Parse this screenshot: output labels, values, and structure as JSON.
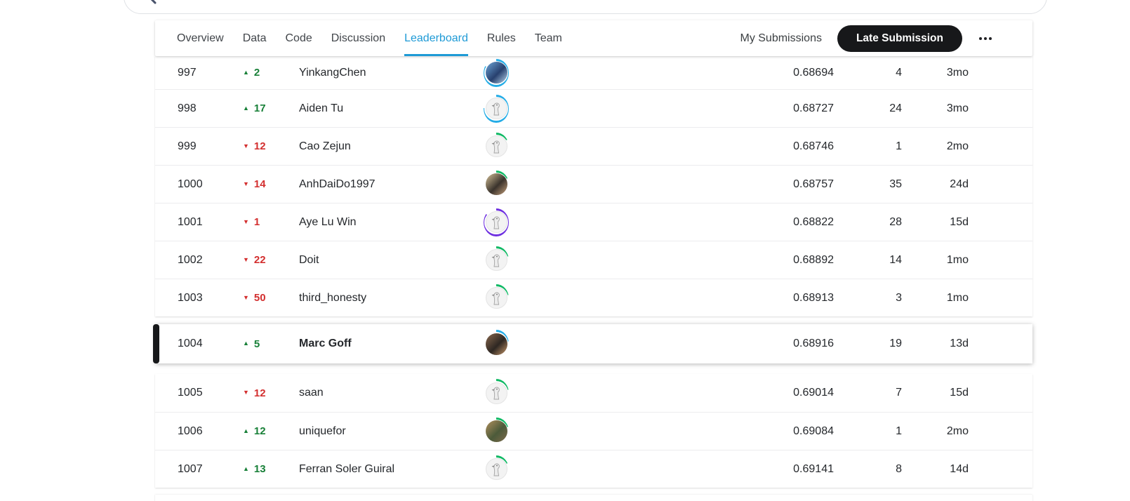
{
  "tabs": {
    "items": [
      "Overview",
      "Data",
      "Code",
      "Discussion",
      "Leaderboard",
      "Rules",
      "Team"
    ],
    "active_index": 4
  },
  "actions": {
    "my_submissions": "My Submissions",
    "late_submission": "Late Submission"
  },
  "icons": {
    "search": "magnifier",
    "more": "ellipsis",
    "up_arrow": "▲",
    "down_arrow": "▼"
  },
  "colors": {
    "accent_blue": "#1e9ad6",
    "positive_green": "#188038",
    "negative_red": "#d32f2f",
    "pill_black": "#17181a",
    "ring_blue": "#24ace6",
    "ring_green": "#0fb964",
    "ring_purple": "#6e30e0"
  },
  "leaderboard": {
    "rows": [
      {
        "rank": "997",
        "dir": "up",
        "change": "2",
        "team": "YinkangChen",
        "score": "0.68694",
        "entries": "4",
        "last": "3mo",
        "avatar": {
          "type": "photo",
          "ring": "#24ace6",
          "ring_pct": 84,
          "photo_colors": [
            "#6ea6d8",
            "#27406e",
            "#b9d6ee"
          ]
        }
      },
      {
        "rank": "998",
        "dir": "up",
        "change": "17",
        "team": "Aiden Tu",
        "score": "0.68727",
        "entries": "24",
        "last": "3mo",
        "avatar": {
          "type": "goose",
          "ring": "#24ace6",
          "ring_pct": 76
        }
      },
      {
        "rank": "999",
        "dir": "down",
        "change": "12",
        "team": "Cao Zejun",
        "score": "0.68746",
        "entries": "1",
        "last": "2mo",
        "avatar": {
          "type": "goose",
          "ring": "#0fb964",
          "ring_pct": 16
        }
      },
      {
        "rank": "1000",
        "dir": "down",
        "change": "14",
        "team": "AnhDaiDo1997",
        "score": "0.68757",
        "entries": "35",
        "last": "24d",
        "avatar": {
          "type": "photo",
          "ring": "#0fb964",
          "ring_pct": 17,
          "photo_colors": [
            "#d8c49a",
            "#3a332c",
            "#c7a17c"
          ]
        }
      },
      {
        "rank": "1001",
        "dir": "down",
        "change": "1",
        "team": "Aye Lu Win",
        "score": "0.68822",
        "entries": "28",
        "last": "15d",
        "avatar": {
          "type": "goose",
          "ring": "#6e30e0",
          "ring_pct": 86
        }
      },
      {
        "rank": "1002",
        "dir": "down",
        "change": "22",
        "team": "Doit",
        "score": "0.68892",
        "entries": "14",
        "last": "1mo",
        "avatar": {
          "type": "goose",
          "ring": "#0fb964",
          "ring_pct": 20
        }
      },
      {
        "rank": "1003",
        "dir": "down",
        "change": "50",
        "team": "third_honesty",
        "score": "0.68913",
        "entries": "3",
        "last": "1mo",
        "avatar": {
          "type": "goose",
          "ring": "#0fb964",
          "ring_pct": 21
        }
      },
      {
        "rank": "1004",
        "dir": "up",
        "change": "5",
        "team": "Marc Goff",
        "score": "0.68916",
        "entries": "19",
        "last": "13d",
        "highlighted": true,
        "avatar": {
          "type": "photo",
          "ring": "#24ace6",
          "ring_pct": 22,
          "photo_colors": [
            "#8a6a4f",
            "#2e2722",
            "#c9996b"
          ]
        }
      },
      {
        "rank": "1005",
        "dir": "down",
        "change": "12",
        "team": "saan",
        "score": "0.69014",
        "entries": "7",
        "last": "15d",
        "avatar": {
          "type": "goose",
          "ring": "#0fb964",
          "ring_pct": 21
        }
      },
      {
        "rank": "1006",
        "dir": "up",
        "change": "12",
        "team": "uniquefor",
        "score": "0.69084",
        "entries": "1",
        "last": "2mo",
        "avatar": {
          "type": "photo",
          "ring": "#0fb964",
          "ring_pct": 19,
          "photo_colors": [
            "#b1905d",
            "#4c5a3a",
            "#7d6a4a"
          ]
        }
      },
      {
        "rank": "1007",
        "dir": "up",
        "change": "13",
        "team": "Ferran Soler Guiral",
        "score": "0.69141",
        "entries": "8",
        "last": "14d",
        "avatar": {
          "type": "goose",
          "ring": "#0fb964",
          "ring_pct": 17
        }
      }
    ]
  }
}
